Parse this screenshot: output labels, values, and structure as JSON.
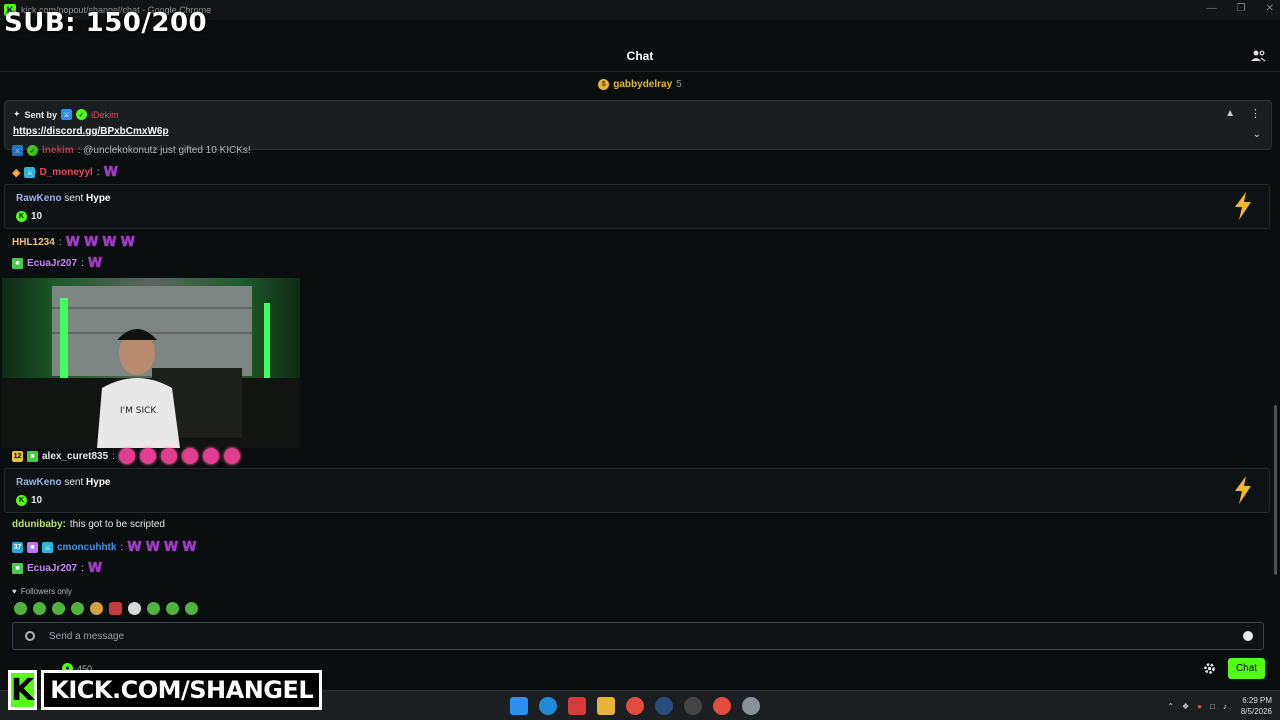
{
  "browser": {
    "tab_title": "kick.com/popout/shangel/chat - Google Chrome"
  },
  "overlay": {
    "sub_count": "SUB: 150/200",
    "kick_letter": "K",
    "kick_url": "KICK.COM/SHANGEL"
  },
  "chat": {
    "title": "Chat",
    "gifter": {
      "name": "gabbydelray",
      "count": "5"
    },
    "pinned": {
      "sent_by_label": "Sent by",
      "sender": "iDekim",
      "link": "https://discord.gg/BPxbCmxW6p"
    },
    "messages": [
      {
        "user": "lnekim",
        "text": ": @unclekokonutz just gifted 10 KICKs!",
        "color": "#e14a5d"
      },
      {
        "user": "D_moneyyl",
        "text": ":",
        "color": "#e14a5d",
        "emotes": 1
      },
      {
        "user": "HHL1234",
        "text": ":",
        "color": "#f0c27a",
        "emotes": 4
      },
      {
        "user": "EcuaJr207",
        "text": ":",
        "color": "#c38af5",
        "emotes": 1
      },
      {
        "user": "alex_curet835",
        "text": ":",
        "color": "#e6e8ea",
        "badge": "12"
      },
      {
        "user": "ddunibaby",
        "text": "this got to be scripted",
        "color": "#b9e36b"
      },
      {
        "user": "cmoncuhhtk",
        "text": ":",
        "color": "#3d8ef0",
        "badge": "37"
      },
      {
        "user": "EcuaJr207",
        "text": ":",
        "color": "#c38af5",
        "emotes": 1
      }
    ],
    "hype": [
      {
        "user": "RawKeno",
        "sent": "sent",
        "item": "Hype",
        "amount": "10"
      },
      {
        "user": "RawKeno",
        "sent": "sent",
        "item": "Hype",
        "amount": "10"
      }
    ],
    "followers_only": "Followers only",
    "input_placeholder": "Send a message",
    "points": "450",
    "send_button": "Chat"
  },
  "taskbar": {
    "time": "6:29 PM",
    "date": "8/5/2026"
  }
}
